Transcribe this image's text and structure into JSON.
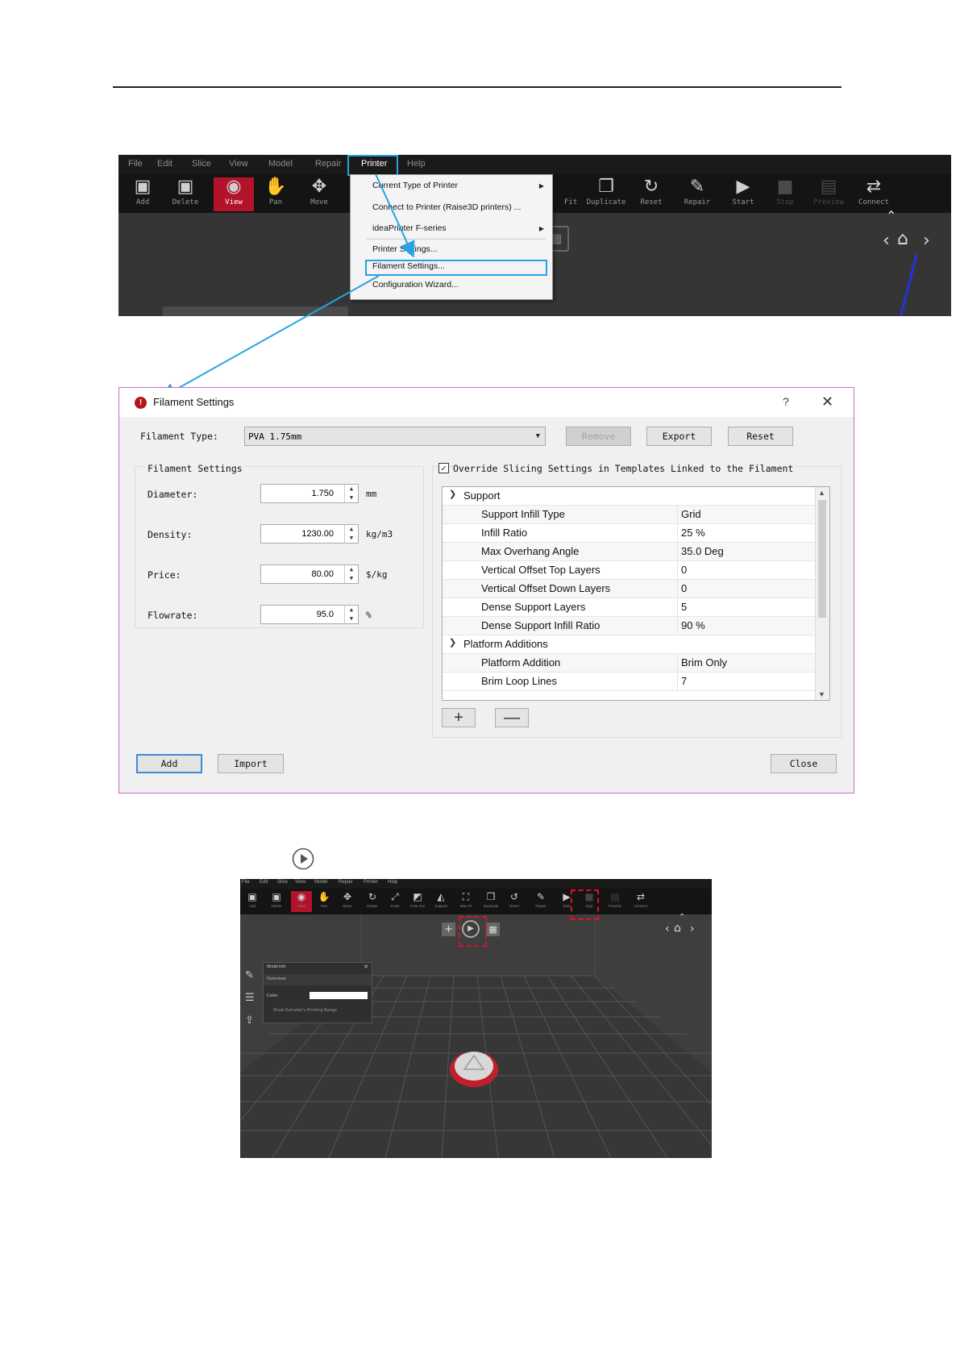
{
  "screenshot1": {
    "menubar": [
      "File",
      "Edit",
      "Slice",
      "View",
      "Model",
      "Repair",
      "Printer",
      "Help"
    ],
    "toolbar": [
      {
        "label": "Add",
        "icon": "cube-add-icon"
      },
      {
        "label": "Delete",
        "icon": "cube-delete-icon"
      },
      {
        "label": "View",
        "icon": "eye-icon",
        "selected": true
      },
      {
        "label": "Pan",
        "icon": "hand-icon"
      },
      {
        "label": "Move",
        "icon": "move-arrows-icon"
      },
      {
        "label": "Fit",
        "icon": "fit-icon"
      },
      {
        "label": "Duplicate",
        "icon": "duplicate-icon"
      },
      {
        "label": "Reset",
        "icon": "reset-icon"
      },
      {
        "label": "Repair",
        "icon": "wrench-icon"
      },
      {
        "label": "Start",
        "icon": "play-icon"
      },
      {
        "label": "Stop",
        "icon": "stop-icon"
      },
      {
        "label": "Preview",
        "icon": "preview-icon"
      },
      {
        "label": "Connect",
        "icon": "connect-icon"
      }
    ],
    "printer_menu": [
      {
        "label": "Current Type of Printer",
        "submenu": true
      },
      {
        "label": "Connect to Printer (Raise3D printers) ...",
        "submenu": false
      },
      {
        "label": "ideaPrinter F-series",
        "submenu": true
      },
      {
        "label": "Printer Settings...",
        "submenu": false
      },
      {
        "label": "Filament Settings...",
        "submenu": false
      },
      {
        "label": "Configuration Wizard...",
        "submenu": false
      }
    ]
  },
  "dialog": {
    "title": "Filament Settings",
    "help": "?",
    "close": "✕",
    "filament_type_label": "Filament Type:",
    "filament_type_value": "PVA 1.75mm",
    "remove_label": "Remove",
    "export_label": "Export",
    "reset_label": "Reset",
    "group_title": "Filament Settings",
    "fields": [
      {
        "label": "Diameter:",
        "value": "1.750",
        "unit": "mm"
      },
      {
        "label": "Density:",
        "value": "1230.00",
        "unit": "kg/m3"
      },
      {
        "label": "Price:",
        "value": "80.00",
        "unit": "$/kg"
      },
      {
        "label": "Flowrate:",
        "value": "95.0",
        "unit": "%"
      }
    ],
    "override_label": "Override Slicing Settings in Templates Linked to the Filament",
    "override_checked": true,
    "tree": [
      {
        "type": "header",
        "label": "Support"
      },
      {
        "type": "row",
        "name": "Support Infill Type",
        "value": "Grid"
      },
      {
        "type": "row",
        "name": "Infill Ratio",
        "value": "25 %"
      },
      {
        "type": "row",
        "name": "Max Overhang Angle",
        "value": "35.0 Deg"
      },
      {
        "type": "row",
        "name": "Vertical Offset Top Layers",
        "value": "0"
      },
      {
        "type": "row",
        "name": "Vertical Offset Down Layers",
        "value": "0"
      },
      {
        "type": "row",
        "name": "Dense Support Layers",
        "value": "5"
      },
      {
        "type": "row",
        "name": "Dense Support Infill Ratio",
        "value": "90 %"
      },
      {
        "type": "header",
        "label": "Platform Additions"
      },
      {
        "type": "row",
        "name": "Platform Addition",
        "value": "Brim Only"
      },
      {
        "type": "row",
        "name": "Brim Loop Lines",
        "value": "7"
      }
    ],
    "plus": "+",
    "minus": "—",
    "add_label": "Add",
    "import_label": "Import",
    "close_label": "Close"
  },
  "colors": {
    "accent_red": "#b2132a",
    "annotation_blue": "#27a3e1",
    "highlight_red": "#e0102a"
  }
}
